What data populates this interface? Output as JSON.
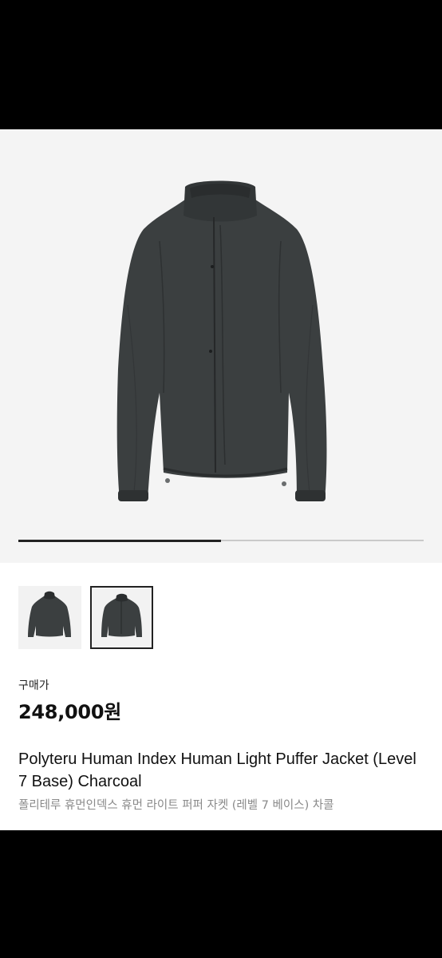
{
  "product": {
    "carousel": {
      "progress": 0.5
    },
    "thumbnails": [
      {
        "name": "thumbnail-1",
        "selected": false
      },
      {
        "name": "thumbnail-2",
        "selected": true
      }
    ],
    "price_label": "구매가",
    "price_value": "248,000원",
    "title_en": "Polyteru Human Index Human Light Puffer Jacket (Level 7 Base) Charcoal",
    "title_ko": "폴리테루 휴먼인덱스 휴먼 라이트 퍼퍼 자켓 (레벨 7 베이스) 차콜"
  },
  "colors": {
    "jacket": "#3b3f40",
    "jacket_shadow": "#2a2d2e",
    "hero_bg": "#f4f4f4",
    "accent": "#222222"
  }
}
